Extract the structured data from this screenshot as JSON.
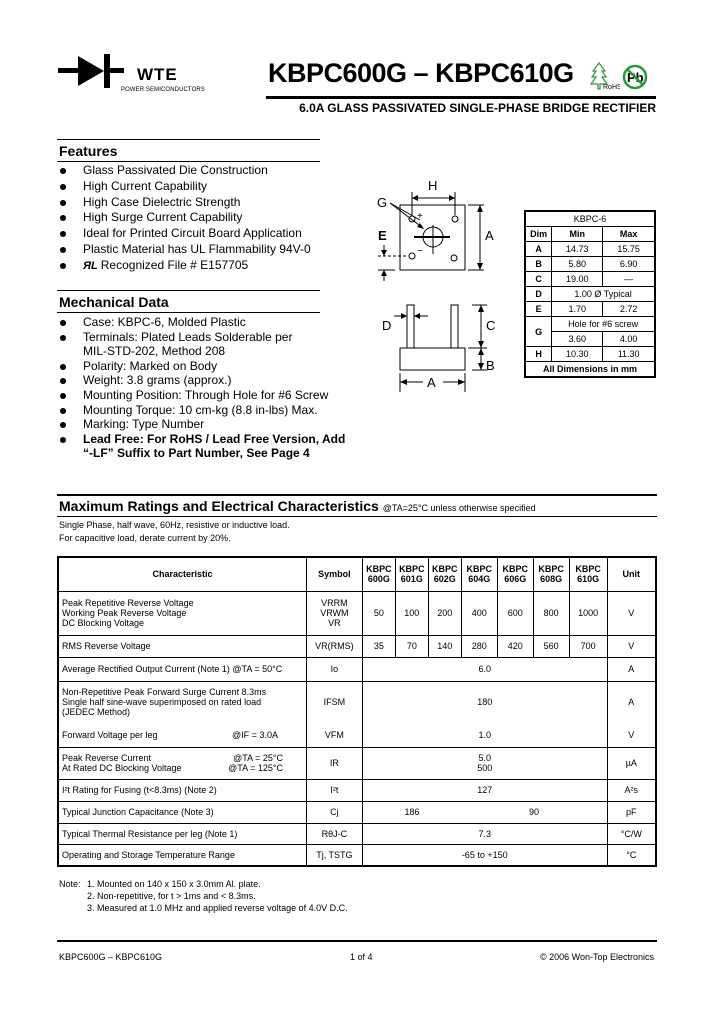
{
  "header": {
    "logo_text": "WTE",
    "logo_subtitle": "POWER SEMICONDUCTORS",
    "title": "KBPC600G – KBPC610G",
    "subtitle": "6.0A GLASS PASSIVATED SINGLE-PHASE BRIDGE RECTIFIER",
    "rohs_label": "RoHS",
    "pb_label": "Pb"
  },
  "features": {
    "heading": "Features",
    "items": [
      "Glass Passivated Die Construction",
      "High Current Capability",
      "High Case Dielectric Strength",
      "High Surge Current Capability",
      "Ideal for Printed Circuit Board Application",
      "Plastic Material has UL Flammability 94V-0",
      "Recognized File # E157705"
    ],
    "ul_mark": "ЯL"
  },
  "mechanical": {
    "heading": "Mechanical Data",
    "items": [
      "Case: KBPC-6, Molded Plastic",
      "Terminals: Plated Leads Solderable per MIL-STD-202, Method 208",
      "Polarity: Marked on Body",
      "Weight: 3.8 grams (approx.)",
      "Mounting Position: Through Hole for #6 Screw",
      "Mounting Torque: 10 cm-kg (8.8 in-lbs) Max.",
      "Marking: Type Number",
      "Lead Free: For RoHS / Lead Free Version, Add “-LF” Suffix to Part Number, See Page 4"
    ]
  },
  "diagram": {
    "labels": {
      "A": "A",
      "B": "B",
      "C": "C",
      "D": "D",
      "E": "E",
      "G": "G",
      "H": "H",
      "plus": "+",
      "minus": "−",
      "tilde": "~"
    }
  },
  "dim_table": {
    "title": "KBPC-6",
    "headers": [
      "Dim",
      "Min",
      "Max"
    ],
    "rows": [
      {
        "dim": "A",
        "min": "14.73",
        "max": "15.75"
      },
      {
        "dim": "B",
        "min": "5.80",
        "max": "6.90"
      },
      {
        "dim": "C",
        "min": "19.00",
        "max": "—"
      },
      {
        "dim": "D",
        "span": "1.00 Ø Typical"
      },
      {
        "dim": "E",
        "min": "1.70",
        "max": "2.72"
      },
      {
        "dim": "G",
        "span": "Hole for #6 screw",
        "min": "3.60",
        "max": "4.00"
      },
      {
        "dim": "H",
        "min": "10.30",
        "max": "11.30"
      }
    ],
    "footer": "All Dimensions in mm"
  },
  "ratings": {
    "heading": "Maximum Ratings and Electrical Characteristics",
    "heading_condition": "@TA=25°C unless otherwise specified",
    "note_lines": [
      "Single Phase, half wave, 60Hz, resistive or inductive load.",
      "For capacitive load, derate current by 20%."
    ],
    "headers": {
      "characteristic": "Characteristic",
      "symbol": "Symbol",
      "parts": [
        [
          "KBPC",
          "600G"
        ],
        [
          "KBPC",
          "601G"
        ],
        [
          "KBPC",
          "602G"
        ],
        [
          "KBPC",
          "604G"
        ],
        [
          "KBPC",
          "606G"
        ],
        [
          "KBPC",
          "608G"
        ],
        [
          "KBPC",
          "610G"
        ]
      ],
      "unit": "Unit"
    },
    "rows": {
      "vrrm": {
        "lines": [
          "Peak Repetitive Reverse Voltage",
          "Working Peak Reverse Voltage",
          "DC Blocking Voltage"
        ],
        "symbols": [
          "VRRM",
          "VRWM",
          "VR"
        ],
        "values": [
          "50",
          "100",
          "200",
          "400",
          "600",
          "800",
          "1000"
        ],
        "unit": "V"
      },
      "vrms": {
        "label": "RMS Reverse Voltage",
        "symbol": "VR(RMS)",
        "values": [
          "35",
          "70",
          "140",
          "280",
          "420",
          "560",
          "700"
        ],
        "unit": "V"
      },
      "io": {
        "label": "Average Rectified Output Current (Note 1) @TA = 50°C",
        "symbol": "Io",
        "value": "6.0",
        "unit": "A"
      },
      "ifsm": {
        "lines": [
          "Non-Repetitive Peak Forward Surge Current 8.3ms",
          "Single half sine-wave superimposed on rated load",
          "(JEDEC Method)"
        ],
        "symbol": "IFSM",
        "value": "180",
        "unit": "A"
      },
      "vfm": {
        "label": "Forward Voltage per leg",
        "condition": "@IF = 3.0A",
        "symbol": "VFM",
        "value": "1.0",
        "unit": "V"
      },
      "ir": {
        "lines": [
          "Peak Reverse Current",
          "At Rated DC Blocking Voltage"
        ],
        "conditions": [
          "@TA = 25°C",
          "@TA = 125°C"
        ],
        "symbol": "IR",
        "values": [
          "5.0",
          "500"
        ],
        "unit": "µA"
      },
      "i2t": {
        "label": "I²t Rating for Fusing (t<8.3ms) (Note 2)",
        "symbol": "I²t",
        "value": "127",
        "unit": "A²s"
      },
      "cj": {
        "label": "Typical Junction Capacitance (Note 3)",
        "symbol": "Cj",
        "value_low": "186",
        "value_high": "90",
        "unit": "pF"
      },
      "rth": {
        "label": "Typical Thermal Resistance per leg (Note 1)",
        "symbol": "RθJ-C",
        "value": "7.3",
        "unit": "°C/W"
      },
      "temp": {
        "label": "Operating and Storage Temperature Range",
        "symbol": "Tj, TSTG",
        "value": "-65 to +150",
        "unit": "°C"
      }
    }
  },
  "notes": {
    "prefix": "Note:",
    "items": [
      "1. Mounted on 140 x 150 x 3.0mm Al. plate.",
      "2. Non-repetitive, for t > 1ms and < 8.3ms.",
      "3. Measured at 1.0 MHz and applied reverse voltage of 4.0V D.C."
    ]
  },
  "footer": {
    "left": "KBPC600G – KBPC610G",
    "center": "1 of 4",
    "right": "© 2006 Won-Top Electronics"
  }
}
